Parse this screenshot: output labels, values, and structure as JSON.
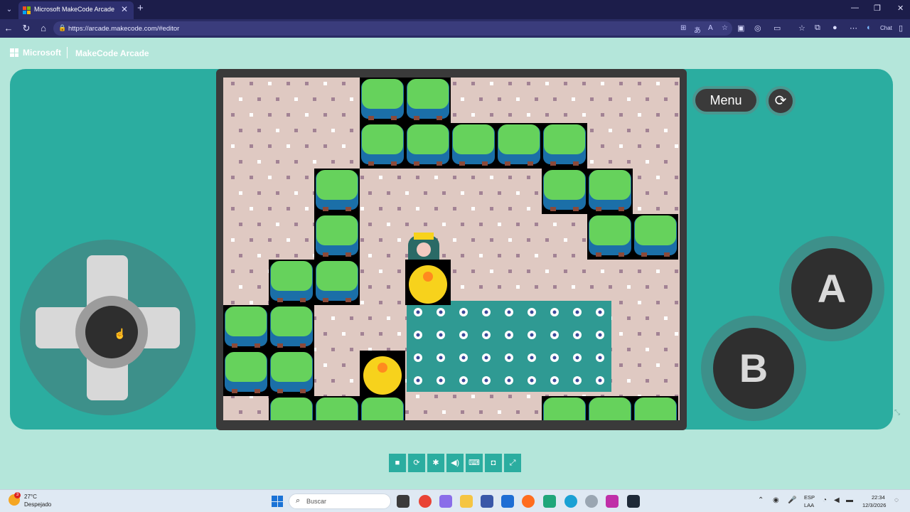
{
  "browser": {
    "tab_title": "Microsoft MakeCode Arcade",
    "url": "https://arcade.makecode.com/#editor",
    "chat_label": "Chat"
  },
  "header": {
    "brand": "Microsoft",
    "app_name": "MakeCode Arcade"
  },
  "simulator": {
    "menu_label": "Menu",
    "button_a": "A",
    "button_b": "B",
    "tile_size": 64,
    "colors": {
      "bush": "#66d25c",
      "bush_shadow": "#1b6fa8",
      "sand": "#dfc9c2",
      "water": "#2f9a93",
      "fruit": "#f7d21c"
    },
    "map": [
      "...BB.....",
      "...BBBBB..",
      "..B....BB.",
      "..B.P...BB",
      ".BB.F.....",
      "BB...WWWW.",
      "BB.F.WWWW.",
      ".BBB...BBB"
    ],
    "map_extra": {
      "water_tiles": [
        [
          4,
          4
        ],
        [
          4,
          5
        ],
        [
          5,
          4
        ],
        [
          5,
          5
        ],
        [
          6,
          4
        ],
        [
          6,
          5
        ],
        [
          7,
          4
        ],
        [
          7,
          5
        ],
        [
          8,
          4
        ],
        [
          8,
          5
        ],
        [
          9,
          4
        ],
        [
          9,
          5
        ],
        [
          10,
          4
        ],
        [
          10,
          5
        ],
        [
          11,
          4
        ],
        [
          11,
          5
        ],
        [
          12,
          4
        ],
        [
          12,
          5
        ],
        [
          4,
          6
        ],
        [
          4,
          7
        ],
        [
          5,
          6
        ],
        [
          5,
          7
        ],
        [
          6,
          6
        ],
        [
          6,
          7
        ],
        [
          7,
          6
        ],
        [
          7,
          7
        ],
        [
          8,
          6
        ],
        [
          8,
          7
        ],
        [
          9,
          6
        ],
        [
          9,
          7
        ],
        [
          10,
          6
        ],
        [
          10,
          7
        ],
        [
          11,
          6
        ],
        [
          11,
          7
        ],
        [
          12,
          6
        ],
        [
          12,
          7
        ]
      ]
    }
  },
  "toolbar": {
    "icons": [
      "stop-icon",
      "restart-icon",
      "debug-icon",
      "sound-icon",
      "keyboard-icon",
      "screenshot-icon",
      "fullscreen-icon"
    ]
  },
  "taskbar": {
    "weather_temp": "27°C",
    "weather_desc": "Despejado",
    "weather_badge": "3",
    "search_placeholder": "Buscar",
    "lang_top": "ESP",
    "lang_bottom": "LAA",
    "time": "22:34",
    "date": "12/3/2026"
  }
}
